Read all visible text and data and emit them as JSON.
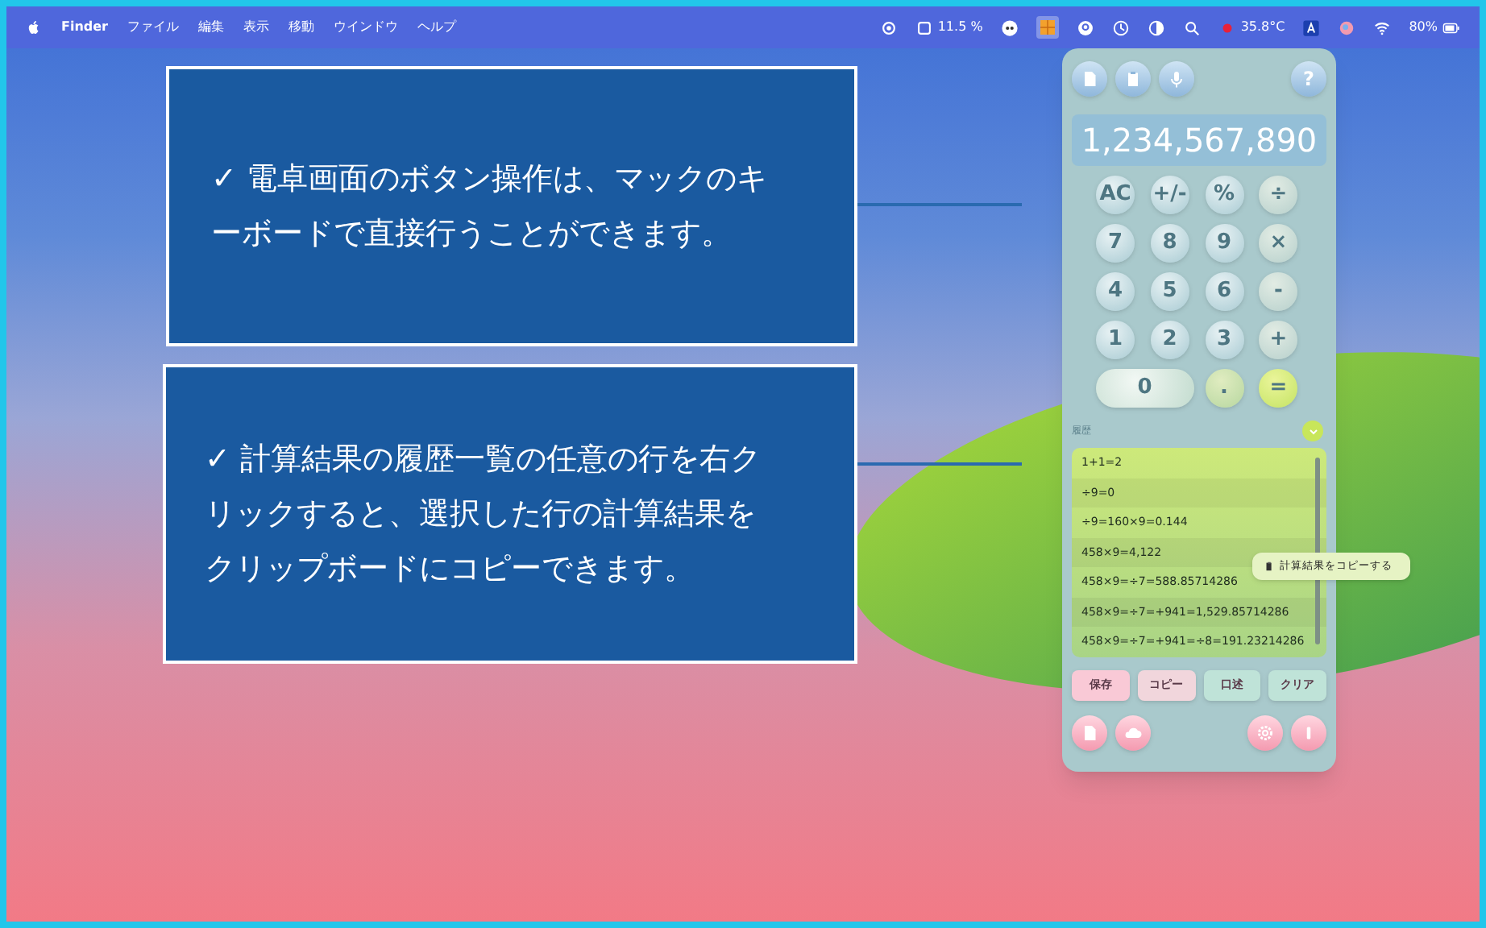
{
  "menubar": {
    "app_name": "Finder",
    "menus": [
      "ファイル",
      "編集",
      "表示",
      "移動",
      "ウインドウ",
      "ヘルプ"
    ],
    "status": [
      {
        "kind": "eye"
      },
      {
        "kind": "cpu",
        "text": "11.5 %"
      },
      {
        "kind": "badge"
      },
      {
        "kind": "app",
        "selected": true
      },
      {
        "kind": "p"
      },
      {
        "kind": "clock"
      },
      {
        "kind": "contrast"
      },
      {
        "kind": "search"
      },
      {
        "kind": "temp",
        "text": "35.8°C"
      },
      {
        "kind": "a"
      },
      {
        "kind": "ball"
      },
      {
        "kind": "wifi"
      },
      {
        "kind": "battery",
        "text": "80%"
      }
    ]
  },
  "callouts": [
    "✓ 電卓画面のボタン操作は、マックのキーボードで直接行うことができます。",
    "✓ 計算結果の履歴一覧の任意の行を右クリックすると、選択した行の計算結果をクリップボードにコピーできます。"
  ],
  "calculator": {
    "toolbar": [
      {
        "kind": "doc"
      },
      {
        "kind": "paste"
      },
      {
        "kind": "mic"
      }
    ],
    "help": "?",
    "display": "1,234,567,890",
    "keys": [
      {
        "label": "AC",
        "kind": "fn"
      },
      {
        "label": "+/-",
        "kind": "fn"
      },
      {
        "label": "%",
        "kind": "fn"
      },
      {
        "label": "÷",
        "kind": "op"
      },
      {
        "label": "7",
        "kind": "digit"
      },
      {
        "label": "8",
        "kind": "digit"
      },
      {
        "label": "9",
        "kind": "digit"
      },
      {
        "label": "×",
        "kind": "op"
      },
      {
        "label": "4",
        "kind": "digit"
      },
      {
        "label": "5",
        "kind": "digit"
      },
      {
        "label": "6",
        "kind": "digit"
      },
      {
        "label": "-",
        "kind": "op"
      },
      {
        "label": "1",
        "kind": "digit"
      },
      {
        "label": "2",
        "kind": "digit"
      },
      {
        "label": "3",
        "kind": "digit"
      },
      {
        "label": "+",
        "kind": "op"
      },
      {
        "label": "0",
        "kind": "zero"
      },
      {
        "label": ".",
        "kind": "dot"
      },
      {
        "label": "=",
        "kind": "equals"
      }
    ],
    "history_label": "履歴",
    "history": [
      "1+1=2",
      "÷9=0",
      "÷9=160×9=0.144",
      "458×9=4,122",
      "458×9=÷7=588.85714286",
      "458×9=÷7=+941=1,529.85714286",
      "458×9=÷7=+941=÷8=191.23214286"
    ],
    "context_menu": "計算結果をコピーする",
    "actions": [
      {
        "label": "保存",
        "color": "#f9c9d6"
      },
      {
        "label": "コピー",
        "color": "#f1d6dc"
      },
      {
        "label": "口述",
        "color": "#bfe3d8"
      },
      {
        "label": "クリア",
        "color": "#bfe3d8"
      }
    ],
    "bottom": [
      {
        "kind": "doc"
      },
      {
        "kind": "cloud"
      },
      {
        "kind": "gear"
      },
      {
        "kind": "info"
      }
    ]
  }
}
